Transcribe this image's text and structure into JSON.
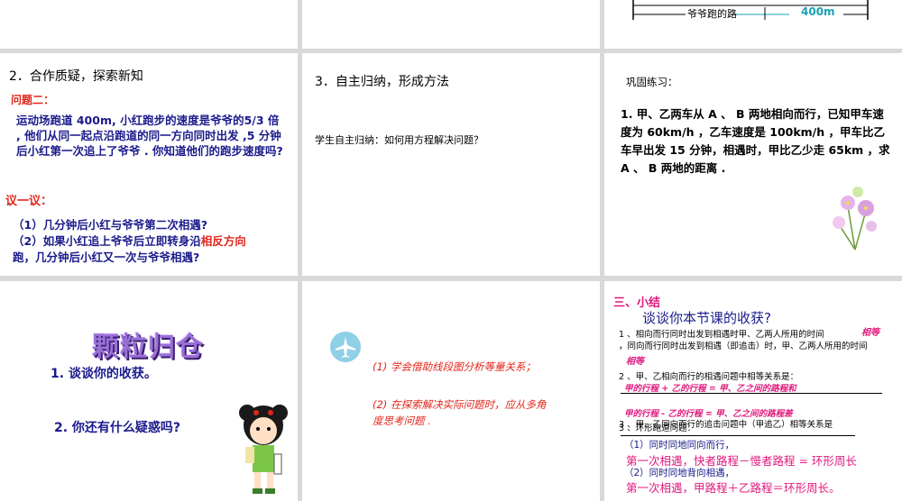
{
  "grid": {
    "top_right": {
      "label_path": "爷爷跑的路",
      "label_400": "400m"
    }
  },
  "slide4": {
    "heading": "2．合作质疑，探索新知",
    "question_label": "问题二：",
    "problem": "运动场跑道 400m, 小红跑步的速度是爷爷的5/3 倍 , 他们从同一起点沿跑道的同一方向同时出发 ,5 分钟后小红第一次追上了爷爷 . 你知道他们的跑步速度吗?",
    "discuss_label": "议一议：",
    "q1": "（1）几分钟后小红与爷爷第二次相遇?",
    "q2_a": "（2）如果小红追上爷爷后立即转身沿",
    "q2_highlight": "相反方向",
    "q2_b": "跑，几分钟后小红又一次与爷爷相遇?"
  },
  "slide5": {
    "heading": "3．自主归纳，形成方法",
    "body": "学生自主归纳：如何用方程解决问题？"
  },
  "slide6": {
    "heading": "巩固练习：",
    "body": "1. 甲、乙两车从 A 、 B 两地相向而行，已知甲车速度为 60km/h ，乙车速度是 100km/h ，甲车比乙车早出发 15 分钟，相遇时，甲比乙少走 65km ，求 A 、 B 两地的距离 ."
  },
  "slide7": {
    "title_art": "颗粒归仓",
    "item1": "1. 谈谈你的收获。",
    "item2": "2. 你还有什么疑惑吗?"
  },
  "slide8": {
    "p1": "(1) 学会借助线段图分析等量关系；",
    "p2": "(2) 在探索解决实际问题时，应从多角度思考问题 ."
  },
  "slide9": {
    "heading": "三、小结",
    "subtitle": "谈谈你本节课的收获?",
    "l1": "1 、相向而行同时出发到相遇时甲、乙两人所用的时间",
    "hw1": "相等",
    "l2": "，同向而行同时出发到相遇（即追击）时，甲、乙两人所用的时间",
    "hw2": "相等",
    "l3": "2 、甲、乙相向而行的相遇问题中相等关系是：",
    "hw3": "甲的行程 + 乙的行程 = 甲、乙之间的路程和",
    "hw4": "甲的行程 - 乙的行程 = 甲、乙之间的路程差",
    "l4": "3 、甲、乙同向而行的追击问题中（甲追乙）相等关系是",
    "l5": "3 、环形跑道问题：",
    "l6": "（1）同时同地同向而行，",
    "l7": "第一次相遇，快者路程－慢者路程 = 环形周长",
    "l8": "（2）同时同地背向相遇，",
    "l9": "第一次相遇，甲路程＋乙路程＝环形周长。"
  }
}
